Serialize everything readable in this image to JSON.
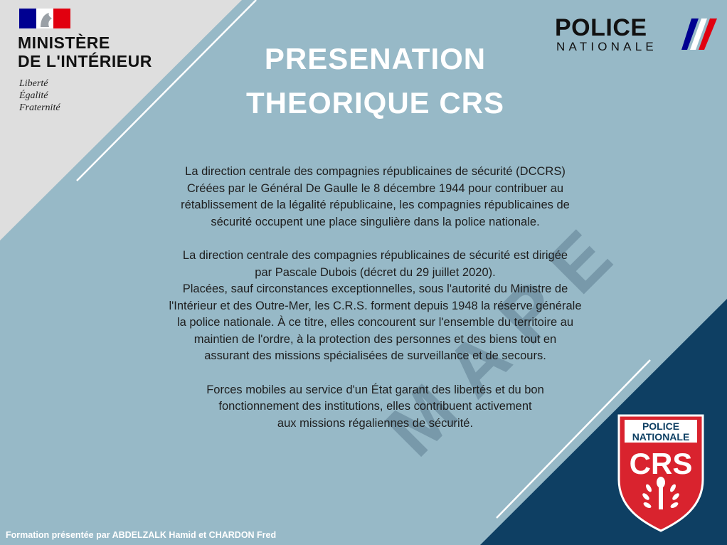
{
  "header": {
    "ministry_line1": "MINISTÈRE",
    "ministry_line2": "DE L'INTÉRIEUR",
    "motto": [
      "Liberté",
      "Égalité",
      "Fraternité"
    ],
    "logo_police": "POLICE",
    "logo_nationale": "NATIONALE"
  },
  "title": {
    "line1": "PRESENATION",
    "line2": "THEORIQUE CRS"
  },
  "body": {
    "para1": [
      "La direction centrale des compagnies républicaines de sécurité (DCCRS)",
      "Créées par le Général De Gaulle le 8 décembre 1944 pour contribuer au",
      "rétablissement de la légalité républicaine, les compagnies républicaines de",
      "sécurité occupent une place singulière dans la police nationale."
    ],
    "para2": [
      "La direction centrale des compagnies républicaines de sécurité est dirigée",
      "par Pascale Dubois (décret du 29 juillet 2020).",
      "Placées, sauf circonstances exceptionnelles, sous l'autorité du Ministre de",
      "l'Intérieur et des Outre-Mer, les C.R.S. forment depuis 1948 la réserve générale",
      "la police nationale. À ce titre, elles concourent sur l'ensemble du territoire au",
      "maintien de l'ordre, à la protection des personnes et des biens tout en",
      "assurant des missions spécialisées de surveillance et de secours."
    ],
    "para3": [
      "Forces mobiles au service d'un État garant des libertés et du bon",
      "fonctionnement des institutions, elles contribuent activement",
      "aux missions régaliennes de sécurité."
    ]
  },
  "badge": {
    "line1": "POLICE",
    "line2": "NATIONALE",
    "line3": "CRS"
  },
  "watermark": "MAPE",
  "footer": "Formation présentée par ABDELZALK Hamid et CHARDON Fred",
  "colors": {
    "background": "#97b9c7",
    "gray_corner": "#dedede",
    "navy_corner": "#0e3f63",
    "badge_red": "#d9232e",
    "flag_blue": "#000091",
    "flag_red": "#e1000f"
  }
}
